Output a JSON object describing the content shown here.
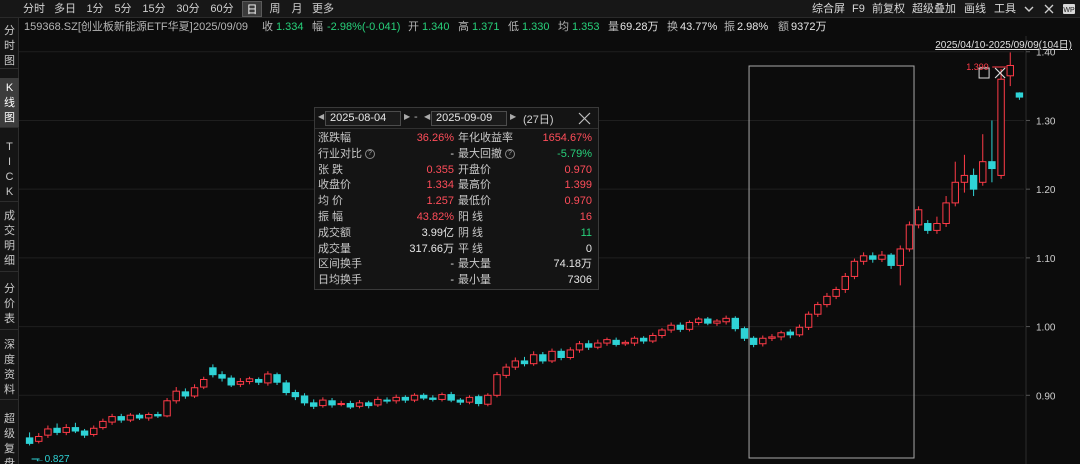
{
  "toolbar": {
    "periods": [
      "分时",
      "多日",
      "1分",
      "5分",
      "15分",
      "30分",
      "60分",
      "日",
      "周",
      "月",
      "更多"
    ],
    "active_period": "日",
    "tools": [
      "综合屏",
      "F9",
      "前复权",
      "超级叠加",
      "画线",
      "工具"
    ]
  },
  "quote": {
    "code_name": "159368.SZ[创业板新能源ETF华夏]",
    "date": "2025/09/09",
    "close_label": "收",
    "close": "1.334",
    "change_label": "幅",
    "change": "-2.98%(-0.041)",
    "open_label": "开",
    "open": "1.340",
    "high_label": "高",
    "high": "1.371",
    "low_label": "低",
    "low": "1.330",
    "avg_label": "均",
    "avg": "1.353",
    "volume_label": "量",
    "volume": "69.28万",
    "turnover_label": "换",
    "turnover": "43.77%",
    "amplitude_label": "振",
    "amplitude": "2.98%",
    "amount_label": "额",
    "amount": "9372万"
  },
  "sidebar": {
    "tabs": [
      "分\n时\n图",
      "K\n线\n图",
      "T\nI\nC\nK",
      "成\n交\n明\n细",
      "分\n价\n表",
      "深\n度\n资\n料",
      "超\n级\n复\n盘"
    ],
    "active_index": 1
  },
  "range_label": "2025/04/10-2025/09/09(104日)",
  "popup": {
    "start_date": "2025-08-04",
    "end_date": "2025-09-09",
    "days": "(27日)",
    "rows": [
      {
        "l": "涨跌幅",
        "v": "36.26%",
        "vc": "red",
        "l2": "年化收益率",
        "v2": "1654.67%",
        "v2c": "red"
      },
      {
        "l": "行业对比",
        "q": true,
        "v": "-",
        "vc": "white",
        "l2": "最大回撤",
        "q2": true,
        "v2": "-5.79%",
        "v2c": "green"
      },
      {
        "l": "张  跌",
        "v": "0.355",
        "vc": "red",
        "l2": "开盘价",
        "v2": "0.970",
        "v2c": "red"
      },
      {
        "l": "收盘价",
        "v": "1.334",
        "vc": "red",
        "l2": "最高价",
        "v2": "1.399",
        "v2c": "red"
      },
      {
        "l": "均  价",
        "v": "1.257",
        "vc": "red",
        "l2": "最低价",
        "v2": "0.970",
        "v2c": "red"
      },
      {
        "l": "振  幅",
        "v": "43.82%",
        "vc": "red",
        "l2": "阳  线",
        "v2": "16",
        "v2c": "red"
      },
      {
        "l": "成交额",
        "v": "3.99亿",
        "vc": "white",
        "l2": "阴  线",
        "v2": "11",
        "v2c": "green"
      },
      {
        "l": "成交量",
        "v": "317.66万",
        "vc": "white",
        "l2": "平  线",
        "v2": "0",
        "v2c": "white"
      },
      {
        "l": "区间换手",
        "v": "-",
        "vc": "white",
        "l2": "最大量",
        "v2": "74.18万",
        "v2c": "white"
      },
      {
        "l": "日均换手",
        "v": "-",
        "vc": "white",
        "l2": "最小量",
        "v2": "7306",
        "v2c": "white"
      }
    ]
  },
  "colors": {
    "up": "#ff3b48",
    "down": "#2fd3d6",
    "grid": "#1f1f1f",
    "selection": "#a8a8a8"
  },
  "chart_data": {
    "type": "candlestick",
    "ylim": [
      0.8,
      1.42
    ],
    "yticks": [
      0.9,
      1.0,
      1.1,
      1.2,
      1.3,
      1.4
    ],
    "ytick_labels": [
      "0.90",
      "1.00",
      "1.10",
      "1.20",
      "1.30",
      "1.40"
    ],
    "high_label": "1.399",
    "low_label": "0.827",
    "selection_range": [
      79,
      96
    ],
    "candles": [
      [
        0.838,
        0.83,
        0.846,
        0.827
      ],
      [
        0.833,
        0.84,
        0.845,
        0.83
      ],
      [
        0.842,
        0.851,
        0.856,
        0.838
      ],
      [
        0.852,
        0.846,
        0.859,
        0.842
      ],
      [
        0.846,
        0.853,
        0.858,
        0.842
      ],
      [
        0.853,
        0.848,
        0.86,
        0.845
      ],
      [
        0.848,
        0.842,
        0.851,
        0.838
      ],
      [
        0.843,
        0.852,
        0.856,
        0.84
      ],
      [
        0.853,
        0.862,
        0.866,
        0.85
      ],
      [
        0.861,
        0.869,
        0.873,
        0.857
      ],
      [
        0.869,
        0.864,
        0.873,
        0.86
      ],
      [
        0.864,
        0.871,
        0.874,
        0.861
      ],
      [
        0.871,
        0.867,
        0.874,
        0.864
      ],
      [
        0.867,
        0.872,
        0.875,
        0.863
      ],
      [
        0.872,
        0.87,
        0.876,
        0.867
      ],
      [
        0.87,
        0.892,
        0.896,
        0.868
      ],
      [
        0.892,
        0.906,
        0.912,
        0.888
      ],
      [
        0.905,
        0.899,
        0.91,
        0.895
      ],
      [
        0.899,
        0.911,
        0.916,
        0.896
      ],
      [
        0.912,
        0.923,
        0.927,
        0.909
      ],
      [
        0.94,
        0.93,
        0.945,
        0.926
      ],
      [
        0.93,
        0.925,
        0.935,
        0.92
      ],
      [
        0.925,
        0.915,
        0.929,
        0.912
      ],
      [
        0.916,
        0.92,
        0.925,
        0.912
      ],
      [
        0.92,
        0.924,
        0.927,
        0.916
      ],
      [
        0.923,
        0.919,
        0.926,
        0.915
      ],
      [
        0.918,
        0.931,
        0.935,
        0.914
      ],
      [
        0.93,
        0.919,
        0.933,
        0.915
      ],
      [
        0.918,
        0.904,
        0.922,
        0.9
      ],
      [
        0.904,
        0.898,
        0.908,
        0.893
      ],
      [
        0.899,
        0.889,
        0.903,
        0.885
      ],
      [
        0.889,
        0.884,
        0.894,
        0.88
      ],
      [
        0.885,
        0.893,
        0.897,
        0.882
      ],
      [
        0.892,
        0.886,
        0.896,
        0.882
      ],
      [
        0.887,
        0.888,
        0.892,
        0.884
      ],
      [
        0.888,
        0.883,
        0.892,
        0.88
      ],
      [
        0.884,
        0.889,
        0.893,
        0.881
      ],
      [
        0.889,
        0.885,
        0.892,
        0.881
      ],
      [
        0.886,
        0.894,
        0.898,
        0.883
      ],
      [
        0.893,
        0.892,
        0.897,
        0.888
      ],
      [
        0.892,
        0.897,
        0.901,
        0.888
      ],
      [
        0.897,
        0.893,
        0.9,
        0.889
      ],
      [
        0.893,
        0.9,
        0.903,
        0.89
      ],
      [
        0.9,
        0.896,
        0.903,
        0.893
      ],
      [
        0.896,
        0.894,
        0.9,
        0.891
      ],
      [
        0.894,
        0.901,
        0.904,
        0.891
      ],
      [
        0.901,
        0.893,
        0.905,
        0.89
      ],
      [
        0.893,
        0.89,
        0.896,
        0.886
      ],
      [
        0.89,
        0.897,
        0.9,
        0.887
      ],
      [
        0.898,
        0.888,
        0.901,
        0.884
      ],
      [
        0.887,
        0.9,
        0.903,
        0.884
      ],
      [
        0.9,
        0.93,
        0.934,
        0.897
      ],
      [
        0.929,
        0.941,
        0.946,
        0.925
      ],
      [
        0.941,
        0.95,
        0.955,
        0.937
      ],
      [
        0.95,
        0.946,
        0.956,
        0.942
      ],
      [
        0.946,
        0.959,
        0.964,
        0.943
      ],
      [
        0.959,
        0.95,
        0.963,
        0.946
      ],
      [
        0.95,
        0.964,
        0.968,
        0.947
      ],
      [
        0.964,
        0.955,
        0.968,
        0.951
      ],
      [
        0.955,
        0.966,
        0.97,
        0.952
      ],
      [
        0.966,
        0.975,
        0.979,
        0.962
      ],
      [
        0.975,
        0.97,
        0.98,
        0.966
      ],
      [
        0.97,
        0.976,
        0.981,
        0.967
      ],
      [
        0.976,
        0.981,
        0.984,
        0.972
      ],
      [
        0.98,
        0.974,
        0.984,
        0.971
      ],
      [
        0.975,
        0.977,
        0.98,
        0.972
      ],
      [
        0.976,
        0.983,
        0.986,
        0.972
      ],
      [
        0.983,
        0.979,
        0.986,
        0.975
      ],
      [
        0.979,
        0.987,
        0.991,
        0.976
      ],
      [
        0.987,
        0.995,
        0.998,
        0.983
      ],
      [
        0.995,
        1.002,
        1.006,
        0.991
      ],
      [
        1.002,
        0.996,
        1.006,
        0.992
      ],
      [
        0.996,
        1.006,
        1.009,
        0.993
      ],
      [
        1.006,
        1.011,
        1.014,
        1.002
      ],
      [
        1.011,
        1.005,
        1.014,
        1.002
      ],
      [
        1.005,
        1.008,
        1.011,
        1.001
      ],
      [
        1.007,
        1.012,
        1.016,
        1.003
      ],
      [
        1.012,
        0.997,
        1.015,
        0.993
      ],
      [
        0.997,
        0.983,
        1.0,
        0.979
      ],
      [
        0.983,
        0.974,
        0.986,
        0.97
      ],
      [
        0.975,
        0.983,
        0.987,
        0.971
      ],
      [
        0.983,
        0.985,
        0.989,
        0.979
      ],
      [
        0.985,
        0.991,
        0.994,
        0.98
      ],
      [
        0.992,
        0.988,
        0.996,
        0.983
      ],
      [
        0.988,
        0.999,
        1.003,
        0.985
      ],
      [
        0.999,
        1.018,
        1.022,
        0.995
      ],
      [
        1.018,
        1.032,
        1.036,
        1.014
      ],
      [
        1.032,
        1.044,
        1.049,
        1.028
      ],
      [
        1.044,
        1.054,
        1.058,
        1.04
      ],
      [
        1.054,
        1.073,
        1.078,
        1.049
      ],
      [
        1.073,
        1.095,
        1.099,
        1.069
      ],
      [
        1.095,
        1.103,
        1.108,
        1.09
      ],
      [
        1.103,
        1.098,
        1.108,
        1.093
      ],
      [
        1.098,
        1.104,
        1.11,
        1.094
      ],
      [
        1.104,
        1.089,
        1.107,
        1.084
      ],
      [
        1.089,
        1.113,
        1.118,
        1.06
      ],
      [
        1.113,
        1.148,
        1.153,
        1.109
      ],
      [
        1.148,
        1.17,
        1.175,
        1.143
      ],
      [
        1.15,
        1.14,
        1.155,
        1.135
      ],
      [
        1.14,
        1.15,
        1.16,
        1.135
      ],
      [
        1.15,
        1.18,
        1.19,
        1.145
      ],
      [
        1.18,
        1.21,
        1.24,
        1.175
      ],
      [
        1.21,
        1.22,
        1.25,
        1.195
      ],
      [
        1.22,
        1.2,
        1.23,
        1.19
      ],
      [
        1.21,
        1.24,
        1.28,
        1.205
      ],
      [
        1.24,
        1.23,
        1.3,
        1.21
      ],
      [
        1.22,
        1.36,
        1.375,
        1.215
      ],
      [
        1.365,
        1.38,
        1.399,
        1.35
      ],
      [
        1.34,
        1.334,
        1.341,
        1.33
      ]
    ]
  }
}
